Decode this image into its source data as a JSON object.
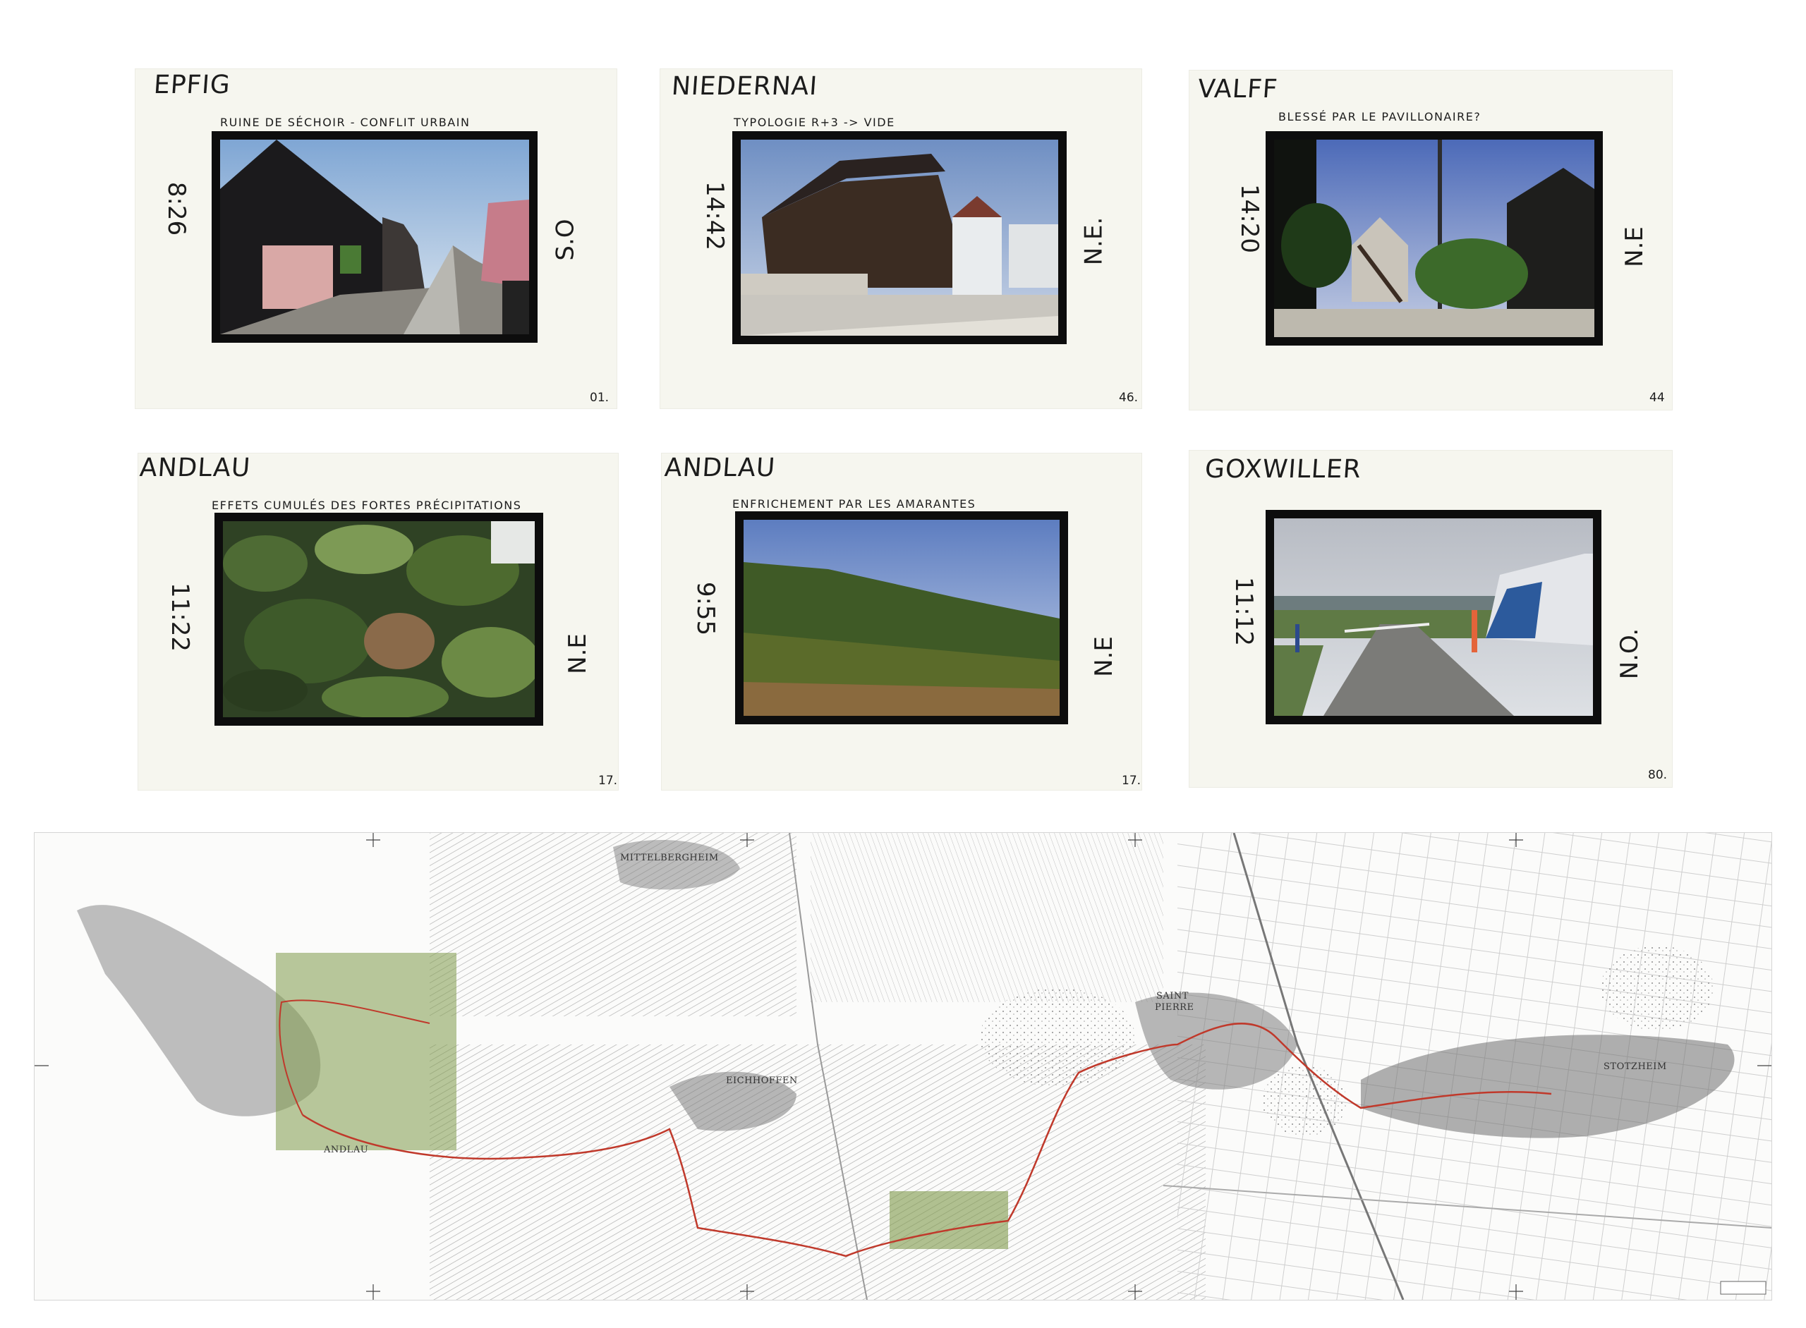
{
  "cards": [
    {
      "place": "EPFIG",
      "caption": "Ruine de séchoir - conflit urbain",
      "time": "8:26",
      "direction": "S.O",
      "number": "01."
    },
    {
      "place": "NIEDERNAI",
      "caption": "Typologie R+3 -> vide",
      "time": "14:42",
      "direction": "N.E.",
      "number": "46."
    },
    {
      "place": "VALFF",
      "caption": "Blessé par le pavillonaire?",
      "time": "14:20",
      "direction": "N.E",
      "number": "44"
    },
    {
      "place": "ANDLAU",
      "caption": "Effets cumulés des fortes précipitations",
      "time": "11:22",
      "direction": "N.E",
      "number": "17."
    },
    {
      "place": "ANDLAU",
      "caption": "Enfrichement par les amarantes",
      "time": "9:55",
      "direction": "N.E",
      "number": "17."
    },
    {
      "place": "GOXWILLER",
      "caption": "",
      "time": "11:12",
      "direction": "N.O.",
      "number": "80."
    }
  ],
  "map": {
    "labels": {
      "mittelbergheim": "MITTELBERGHEIM",
      "andlau": "ANDLAU",
      "eichhoffen": "EICHHOFFEN",
      "saint": "SAINT",
      "pierre": "PIERRE",
      "stotzheim": "STOTZHEIM"
    },
    "colors": {
      "route": "#c0392b",
      "highlight": "#7f9a4a"
    }
  }
}
